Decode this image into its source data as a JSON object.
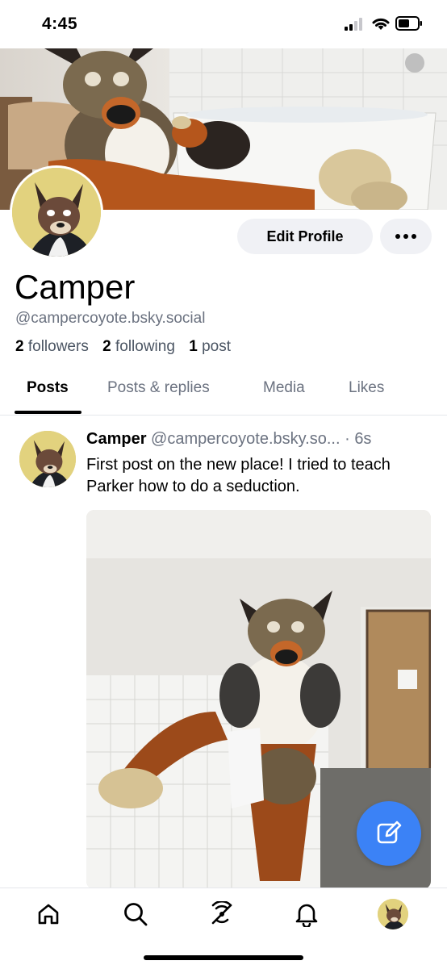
{
  "status_bar": {
    "time": "4:45"
  },
  "profile": {
    "display_name": "Camper",
    "handle": "@campercoyote.bsky.social",
    "followers_count": "2",
    "followers_label": "followers",
    "following_count": "2",
    "following_label": "following",
    "posts_count": "1",
    "posts_label": "post",
    "edit_button_label": "Edit Profile"
  },
  "tabs": [
    {
      "label": "Posts",
      "active": true
    },
    {
      "label": "Posts & replies",
      "active": false
    },
    {
      "label": "Media",
      "active": false
    },
    {
      "label": "Likes",
      "active": false
    }
  ],
  "post": {
    "author": "Camper",
    "handle": "@campercoyote.bsky.so...",
    "separator": "·",
    "time": "6s",
    "text": "First post on the new place! I tried to teach Parker how to do a seduction."
  },
  "bottom_nav": {
    "icons": [
      "home-icon",
      "search-icon",
      "feeds-icon",
      "notifications-icon",
      "profile-avatar"
    ]
  },
  "colors": {
    "accent": "#3b82f6",
    "muted_text": "#6b7280",
    "pill_bg": "#f0f1f5"
  }
}
